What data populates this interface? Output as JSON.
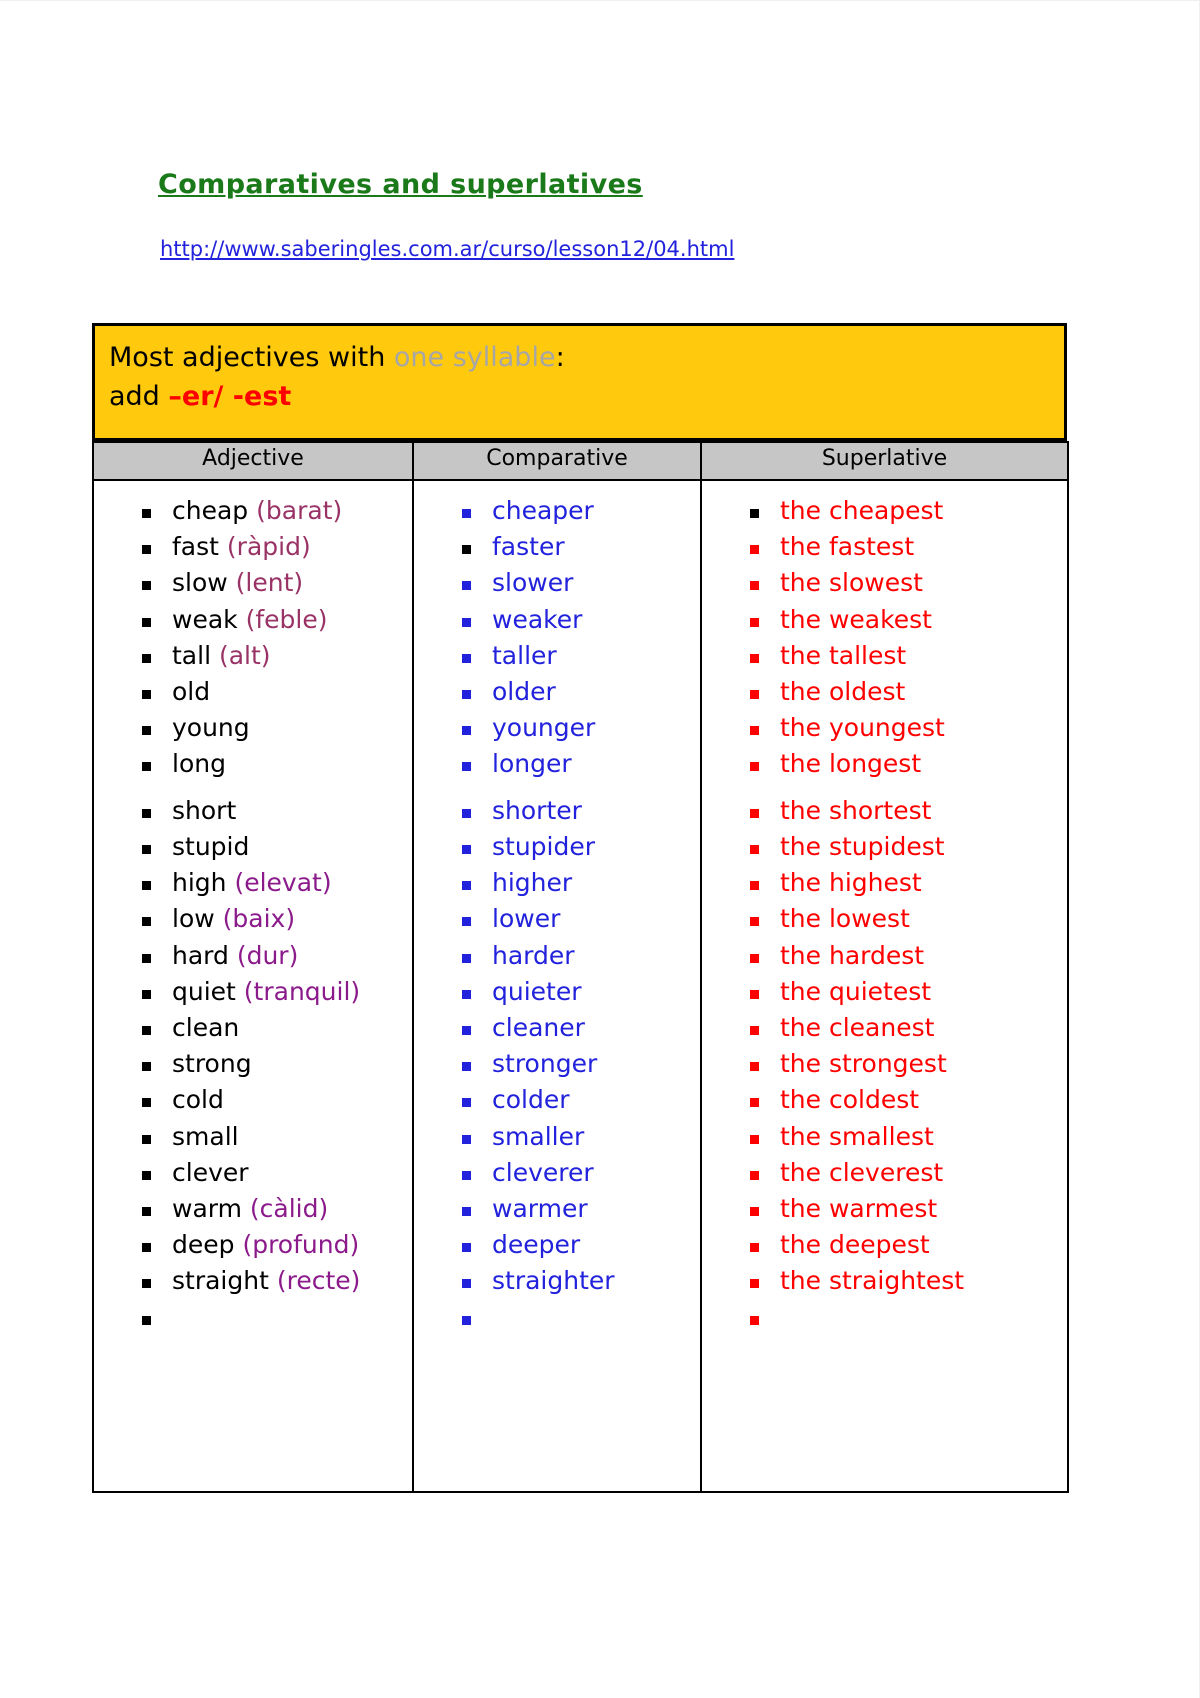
{
  "document": {
    "title": "Comparatives and superlatives",
    "url": "http://www.saberingles.com.ar/curso/lesson12/04.html"
  },
  "rule_box": {
    "line1_prefix": "Most adjectives with ",
    "line1_highlight": "one syllable",
    "line1_suffix": ":",
    "line2_prefix": "add ",
    "line2_suffix": "–er/  -est",
    "bg_color": "#FFC90E",
    "highlight_color": "#a6a6a6",
    "suffix_color": "#ff0000"
  },
  "table": {
    "headers": [
      "Adjective",
      "Comparative",
      "Superlative"
    ],
    "header_bg": "#c6c6c6",
    "adjective_color": "#000000",
    "comparative_color": "#2222dd",
    "superlative_color": "#ff0000",
    "translation_color": "#8B1A8B",
    "adjectives": [
      {
        "word": "cheap",
        "translation": "(barat)"
      },
      {
        "word": "fast",
        "translation": "(ràpid)"
      },
      {
        "word": "slow",
        "translation": "(lent)"
      },
      {
        "word": "weak",
        "translation": "(feble)"
      },
      {
        "word": "tall",
        "translation": "(alt)"
      },
      {
        "word": "old",
        "translation": ""
      },
      {
        "word": "young",
        "translation": ""
      },
      {
        "word": "long",
        "translation": ""
      },
      {
        "word": "short",
        "translation": ""
      },
      {
        "word": "stupid",
        "translation": ""
      },
      {
        "word": "high",
        "translation": "(elevat)"
      },
      {
        "word": "low",
        "translation": "(baix)"
      },
      {
        "word": "hard",
        "translation": "(dur)"
      },
      {
        "word": "quiet",
        "translation": "(tranquil)"
      },
      {
        "word": "clean",
        "translation": ""
      },
      {
        "word": "strong",
        "translation": ""
      },
      {
        "word": "cold",
        "translation": ""
      },
      {
        "word": "small",
        "translation": ""
      },
      {
        "word": "clever",
        "translation": ""
      },
      {
        "word": "warm",
        "translation": "(càlid)"
      },
      {
        "word": "deep",
        "translation": "(profund)"
      },
      {
        "word": "straight",
        "translation": "(recte)"
      },
      {
        "word": "",
        "translation": ""
      }
    ],
    "comparatives": [
      "cheaper",
      "faster",
      "slower",
      "weaker",
      "taller",
      "older",
      "younger",
      "longer",
      "shorter",
      "stupider",
      "higher",
      "lower",
      "harder",
      "quieter",
      "cleaner",
      "stronger",
      "colder",
      "smaller",
      "cleverer",
      "warmer",
      "deeper",
      "straighter",
      ""
    ],
    "superlatives": [
      "the cheapest",
      "the fastest",
      "the slowest",
      "the weakest",
      "the tallest",
      "the oldest",
      "the youngest",
      "the longest",
      "the shortest",
      "the stupidest",
      "the highest",
      "the lowest",
      "the hardest",
      "the quietest",
      "the cleanest",
      "the strongest",
      "the coldest",
      "the smallest",
      "the cleverest",
      "the warmest",
      "the deepest",
      "the straightest",
      ""
    ]
  }
}
